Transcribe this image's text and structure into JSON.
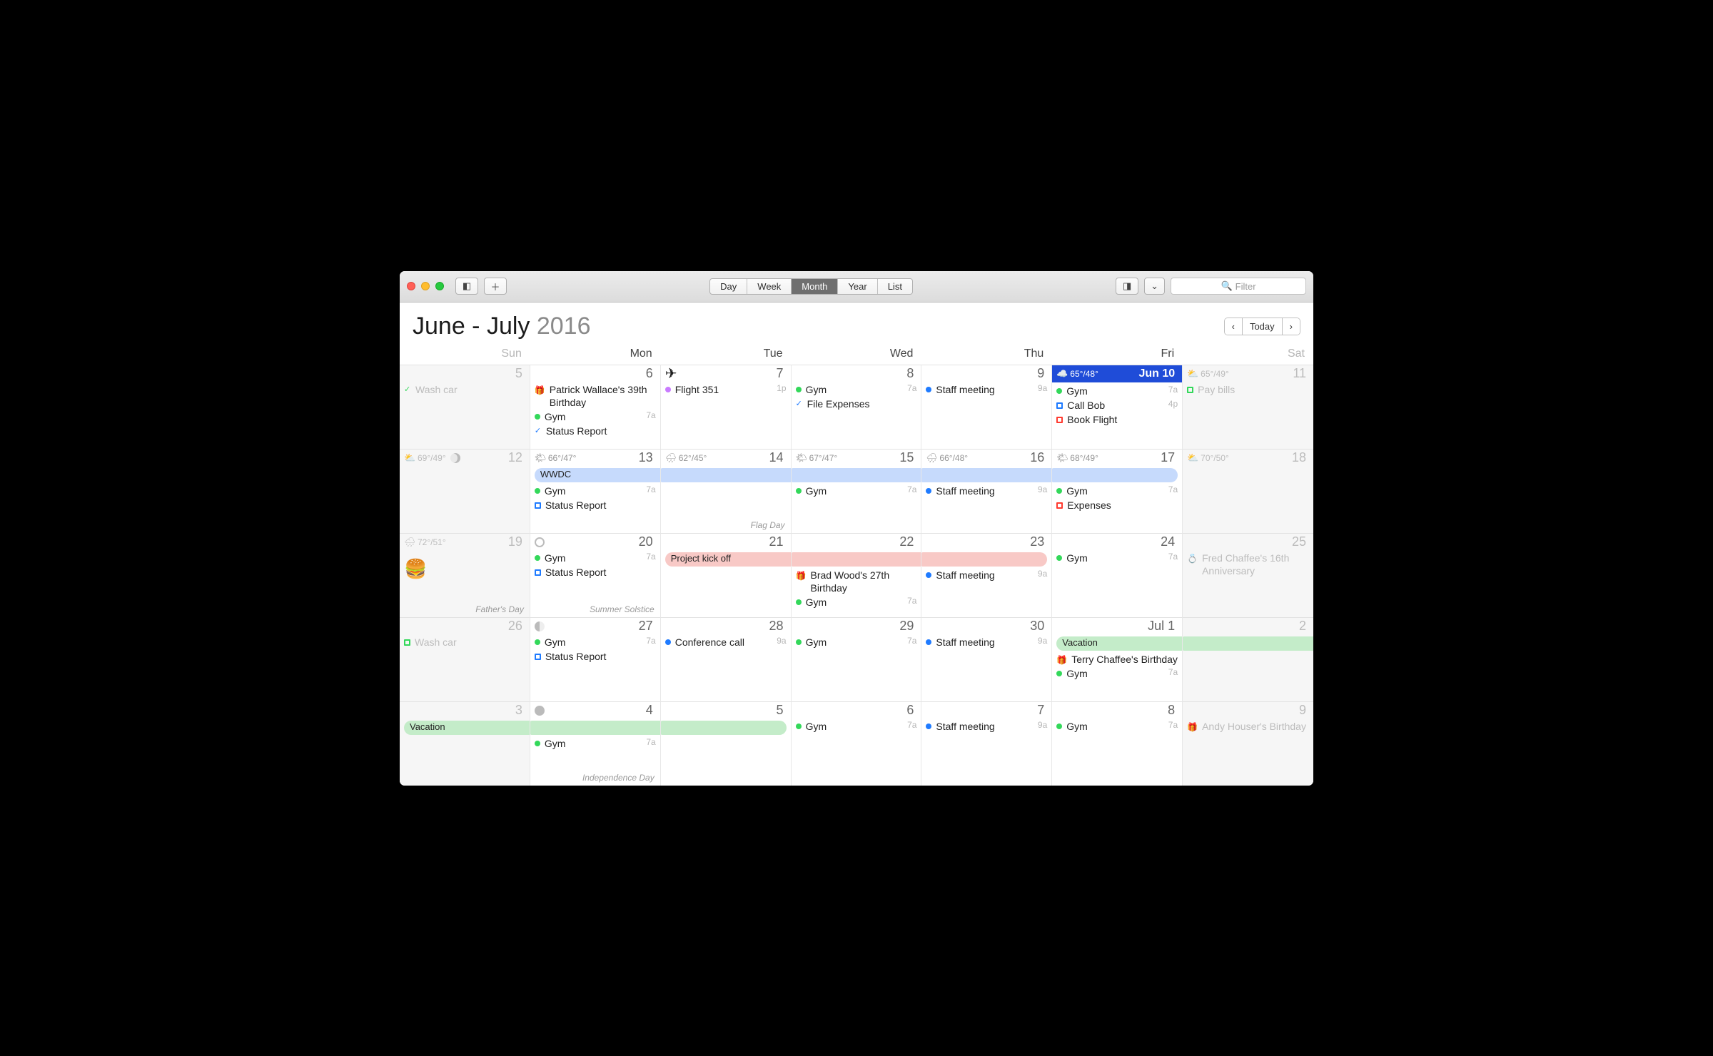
{
  "toolbar": {
    "views": [
      "Day",
      "Week",
      "Month",
      "Year",
      "List"
    ],
    "active_view": "Month",
    "filter_placeholder": "Filter"
  },
  "header": {
    "title_range": "June - July",
    "year": "2016",
    "today_label": "Today"
  },
  "daysOfWeek": [
    "Sun",
    "Mon",
    "Tue",
    "Wed",
    "Thu",
    "Fri",
    "Sat"
  ],
  "weeks": [
    [
      {
        "date": "5",
        "dim": true,
        "events": [
          {
            "kind": "check",
            "color": "green",
            "title": "Wash car"
          }
        ]
      },
      {
        "date": "6",
        "events": [
          {
            "kind": "gift",
            "title": "Patrick Wallace's 39th Birthday"
          },
          {
            "kind": "dot",
            "color": "green",
            "title": "Gym",
            "time": "7a"
          },
          {
            "kind": "check",
            "color": "blue",
            "title": "Status Report"
          }
        ]
      },
      {
        "date": "7",
        "topIcon": "plane",
        "events": [
          {
            "kind": "dot",
            "color": "purple",
            "title": "Flight 351",
            "time": "1p"
          }
        ]
      },
      {
        "date": "8",
        "events": [
          {
            "kind": "dot",
            "color": "green",
            "title": "Gym",
            "time": "7a"
          },
          {
            "kind": "check",
            "color": "blue",
            "title": "File Expenses"
          }
        ]
      },
      {
        "date": "9",
        "events": [
          {
            "kind": "dot",
            "color": "blue",
            "title": "Staff meeting",
            "time": "9a"
          }
        ]
      },
      {
        "date": "Jun 10",
        "today": true,
        "weather": {
          "icon": "☁️",
          "hi": "65°",
          "lo": "48°"
        },
        "events": [
          {
            "kind": "dot",
            "color": "green",
            "title": "Gym",
            "time": "7a"
          },
          {
            "kind": "sq",
            "color": "blue",
            "title": "Call Bob",
            "time": "4p"
          },
          {
            "kind": "sq",
            "color": "red",
            "title": "Book Flight"
          }
        ]
      },
      {
        "date": "11",
        "dim": true,
        "weather": {
          "icon": "⛅",
          "hi": "65°",
          "lo": "49°"
        },
        "events": [
          {
            "kind": "sq",
            "color": "green",
            "title": "Pay bills"
          }
        ]
      }
    ],
    [
      {
        "date": "12",
        "dim": true,
        "weather": {
          "icon": "⛅",
          "hi": "69°",
          "lo": "49°"
        },
        "moon": "half"
      },
      {
        "date": "13",
        "weather": {
          "icon": "🌤",
          "hi": "66°",
          "lo": "47°"
        },
        "bar": {
          "title": "WWDC",
          "color": "blue",
          "start": true
        },
        "events": [
          {
            "kind": "dot",
            "color": "green",
            "title": "Gym",
            "time": "7a"
          },
          {
            "kind": "sq",
            "color": "blue",
            "title": "Status Report"
          }
        ]
      },
      {
        "date": "14",
        "weather": {
          "icon": "🌧",
          "hi": "62°",
          "lo": "45°"
        },
        "barCont": "blue",
        "footnote": "Flag Day"
      },
      {
        "date": "15",
        "weather": {
          "icon": "🌤",
          "hi": "67°",
          "lo": "47°"
        },
        "barCont": "blue",
        "events": [
          {
            "kind": "dot",
            "color": "green",
            "title": "Gym",
            "time": "7a"
          }
        ]
      },
      {
        "date": "16",
        "weather": {
          "icon": "🌧",
          "hi": "66°",
          "lo": "48°"
        },
        "barCont": "blue",
        "events": [
          {
            "kind": "dot",
            "color": "blue",
            "title": "Staff meeting",
            "time": "9a"
          }
        ]
      },
      {
        "date": "17",
        "weather": {
          "icon": "🌤",
          "hi": "68°",
          "lo": "49°"
        },
        "barCont": "blue",
        "barEnd": true,
        "events": [
          {
            "kind": "dot",
            "color": "green",
            "title": "Gym",
            "time": "7a"
          },
          {
            "kind": "sq",
            "color": "red",
            "title": "Expenses"
          }
        ]
      },
      {
        "date": "18",
        "dim": true,
        "weather": {
          "icon": "⛅",
          "hi": "70°",
          "lo": "50°"
        }
      }
    ],
    [
      {
        "date": "19",
        "dim": true,
        "weather": {
          "icon": "🌧",
          "hi": "72°",
          "lo": "51°"
        },
        "burger": true,
        "footnote": "Father's Day"
      },
      {
        "date": "20",
        "moon": "new",
        "events": [
          {
            "kind": "dot",
            "color": "green",
            "title": "Gym",
            "time": "7a"
          },
          {
            "kind": "sq",
            "color": "blue",
            "title": "Status Report"
          }
        ],
        "footnote": "Summer Solstice"
      },
      {
        "date": "21",
        "bar": {
          "title": "Project kick off",
          "color": "pink",
          "start": true
        }
      },
      {
        "date": "22",
        "barCont": "pink",
        "events": [
          {
            "kind": "gift",
            "title": "Brad Wood's 27th Birthday"
          },
          {
            "kind": "dot",
            "color": "green",
            "title": "Gym",
            "time": "7a"
          }
        ]
      },
      {
        "date": "23",
        "barCont": "pink",
        "barEnd": true,
        "events": [
          {
            "kind": "dot",
            "color": "blue",
            "title": "Staff meeting",
            "time": "9a"
          }
        ]
      },
      {
        "date": "24",
        "events": [
          {
            "kind": "dot",
            "color": "green",
            "title": "Gym",
            "time": "7a"
          }
        ]
      },
      {
        "date": "25",
        "dim": true,
        "events": [
          {
            "kind": "ring",
            "title": "Fred Chaffee's 16th Anniversary"
          }
        ]
      }
    ],
    [
      {
        "date": "26",
        "dim": true,
        "events": [
          {
            "kind": "sq",
            "color": "green",
            "title": "Wash car"
          }
        ]
      },
      {
        "date": "27",
        "moon": "quarter",
        "events": [
          {
            "kind": "dot",
            "color": "green",
            "title": "Gym",
            "time": "7a"
          },
          {
            "kind": "sq",
            "color": "blue",
            "title": "Status Report"
          }
        ]
      },
      {
        "date": "28",
        "events": [
          {
            "kind": "dot",
            "color": "blue",
            "title": "Conference call",
            "time": "9a"
          }
        ]
      },
      {
        "date": "29",
        "events": [
          {
            "kind": "dot",
            "color": "green",
            "title": "Gym",
            "time": "7a"
          }
        ]
      },
      {
        "date": "30",
        "events": [
          {
            "kind": "dot",
            "color": "blue",
            "title": "Staff meeting",
            "time": "9a"
          }
        ]
      },
      {
        "date": "Jul 1",
        "bar": {
          "title": "Vacation",
          "color": "green",
          "start": true
        },
        "events": [
          {
            "kind": "gift",
            "title": "Terry Chaffee's Birthday"
          },
          {
            "kind": "dot",
            "color": "green",
            "title": "Gym",
            "time": "7a"
          }
        ]
      },
      {
        "date": "2",
        "dim": true,
        "barCont": "green"
      }
    ],
    [
      {
        "date": "3",
        "dim": true,
        "bar": {
          "title": "Vacation",
          "color": "green",
          "start": true
        }
      },
      {
        "date": "4",
        "barCont": "green",
        "moon": "full",
        "events": [
          {
            "kind": "dot",
            "color": "green",
            "title": "Gym",
            "time": "7a"
          }
        ],
        "footnote": "Independence Day"
      },
      {
        "date": "5",
        "barCont": "green",
        "barEnd": true
      },
      {
        "date": "6",
        "events": [
          {
            "kind": "dot",
            "color": "green",
            "title": "Gym",
            "time": "7a"
          }
        ]
      },
      {
        "date": "7",
        "events": [
          {
            "kind": "dot",
            "color": "blue",
            "title": "Staff meeting",
            "time": "9a"
          }
        ]
      },
      {
        "date": "8",
        "events": [
          {
            "kind": "dot",
            "color": "green",
            "title": "Gym",
            "time": "7a"
          }
        ]
      },
      {
        "date": "9",
        "dim": true,
        "events": [
          {
            "kind": "gift",
            "title": "Andy Houser's Birthday"
          }
        ]
      }
    ]
  ]
}
